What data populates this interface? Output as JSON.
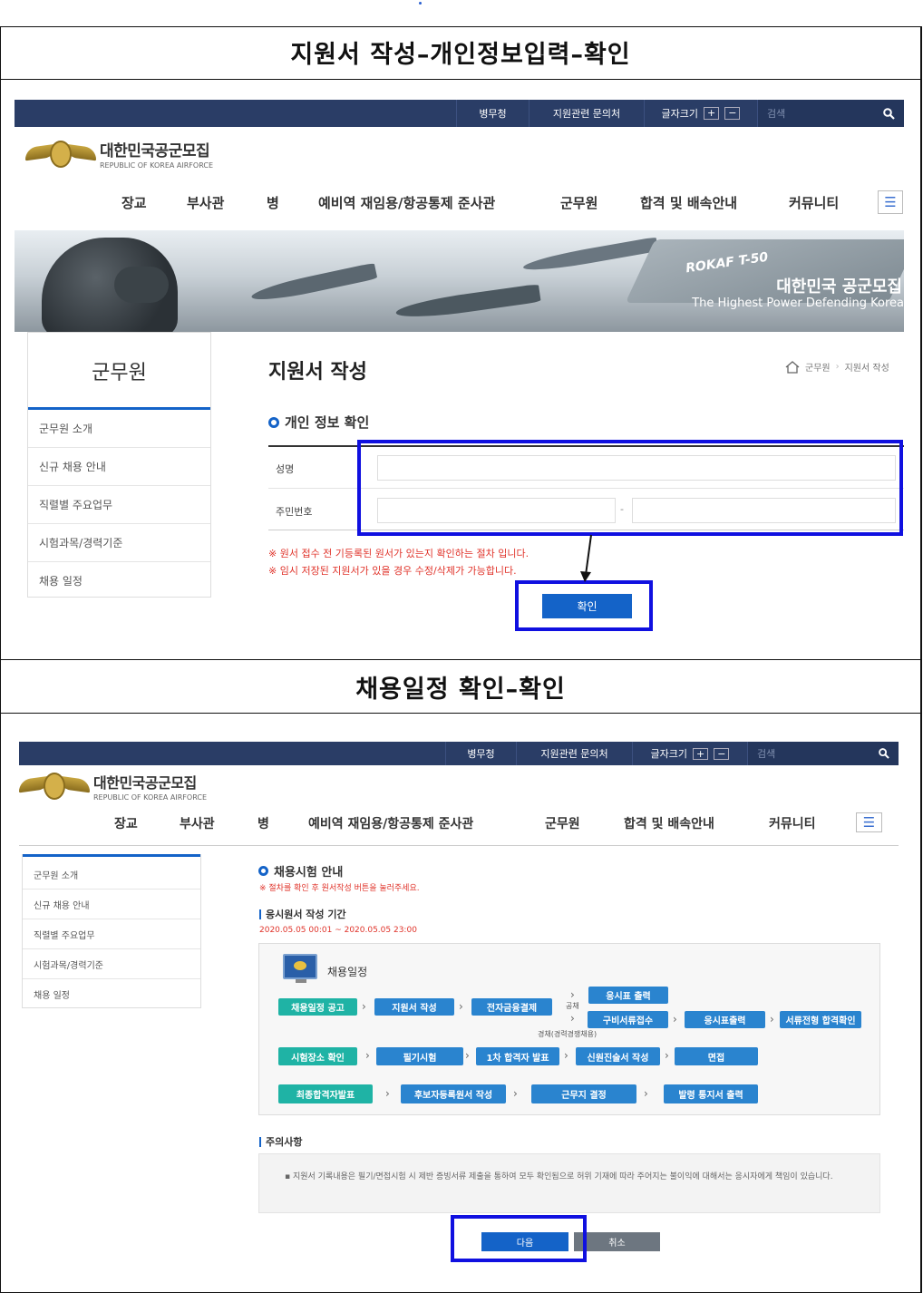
{
  "headers": {
    "section1": "지원서 작성–개인정보입력–확인",
    "section2": "채용일정 확인–확인"
  },
  "topbar": {
    "item1": "병무청",
    "item2": "지원관련 문의처",
    "fontsize": "글자크기",
    "plus": "+",
    "minus": "−",
    "search_placeholder": "검색"
  },
  "logo": {
    "title": "대한민국공군모집",
    "subtitle": "REPUBLIC OF KOREA AIRFORCE"
  },
  "nav": [
    "장교",
    "부사관",
    "병",
    "예비역 재임용/항공통제 준사관",
    "군무원",
    "합격 및 배속안내",
    "커뮤니티"
  ],
  "banner": {
    "title": "대한민국 공군모집",
    "subtitle": "The Highest Power Defending Korea",
    "jet_text": "ROKAF T-50"
  },
  "sidebar": {
    "title": "군무원",
    "items": [
      "군무원 소개",
      "신규 채용 안내",
      "직렬별 주요업무",
      "시험과목/경력기준",
      "채용 일정"
    ]
  },
  "page1": {
    "title": "지원서 작성",
    "breadcrumb": [
      "군무원",
      "지원서 작성"
    ],
    "section_title": "개인 정보 확인",
    "label_name": "성명",
    "label_id": "주민번호",
    "id_dash": "-",
    "note1": "※ 원서 접수 전 기등록된 원서가 있는지 확인하는 절차 입니다.",
    "note2": "※ 임시 저장된 지원서가 있을 경우 수정/삭제가 가능합니다.",
    "confirm": "확인"
  },
  "page2": {
    "section_title": "채용시험 안내",
    "instruction": "※ 절차를 확인 후 원서작성 버튼을 눌러주세요.",
    "period_title": "응시원서 작성 기간",
    "period": "2020.05.05 00:01 ~ 2020.05.05 23:00",
    "schedule_title": "채용일정",
    "flow_row1": [
      "채용일정 공고",
      "지원서 작성",
      "전자금융결제"
    ],
    "flow_top": "응시표 출력",
    "flow_branch": [
      "구비서류접수",
      "응시표출력",
      "서류전형 합격확인"
    ],
    "flow_label_public": "공채",
    "flow_label_career": "경채(경력경쟁채용)",
    "flow_row2": [
      "시험장소 확인",
      "필기시험",
      "1차 합격자 발표",
      "신원진술서 작성",
      "면접"
    ],
    "flow_row3": [
      "최종합격자발표",
      "후보자등록원서 작성",
      "근무지 결정",
      "발령 통지서 출력"
    ],
    "caution_title": "주의사항",
    "caution_text": "▪ 지원서 기록내용은 필기/면접시험 시 제반 증빙서류 제출을 통하여 모두 확인됨으로 허위 기재에 따라 주어지는 불이익에 대해서는 응시자에게 책임이 있습니다.",
    "next": "다음",
    "cancel": "취소"
  },
  "colors": {
    "topbar": "#2a3d66",
    "accent_blue": "#1463c8",
    "highlight": "#1010e0",
    "teal_step": "#1fb3a5",
    "blue_step": "#2a84cf",
    "note_red": "#e0332a"
  }
}
